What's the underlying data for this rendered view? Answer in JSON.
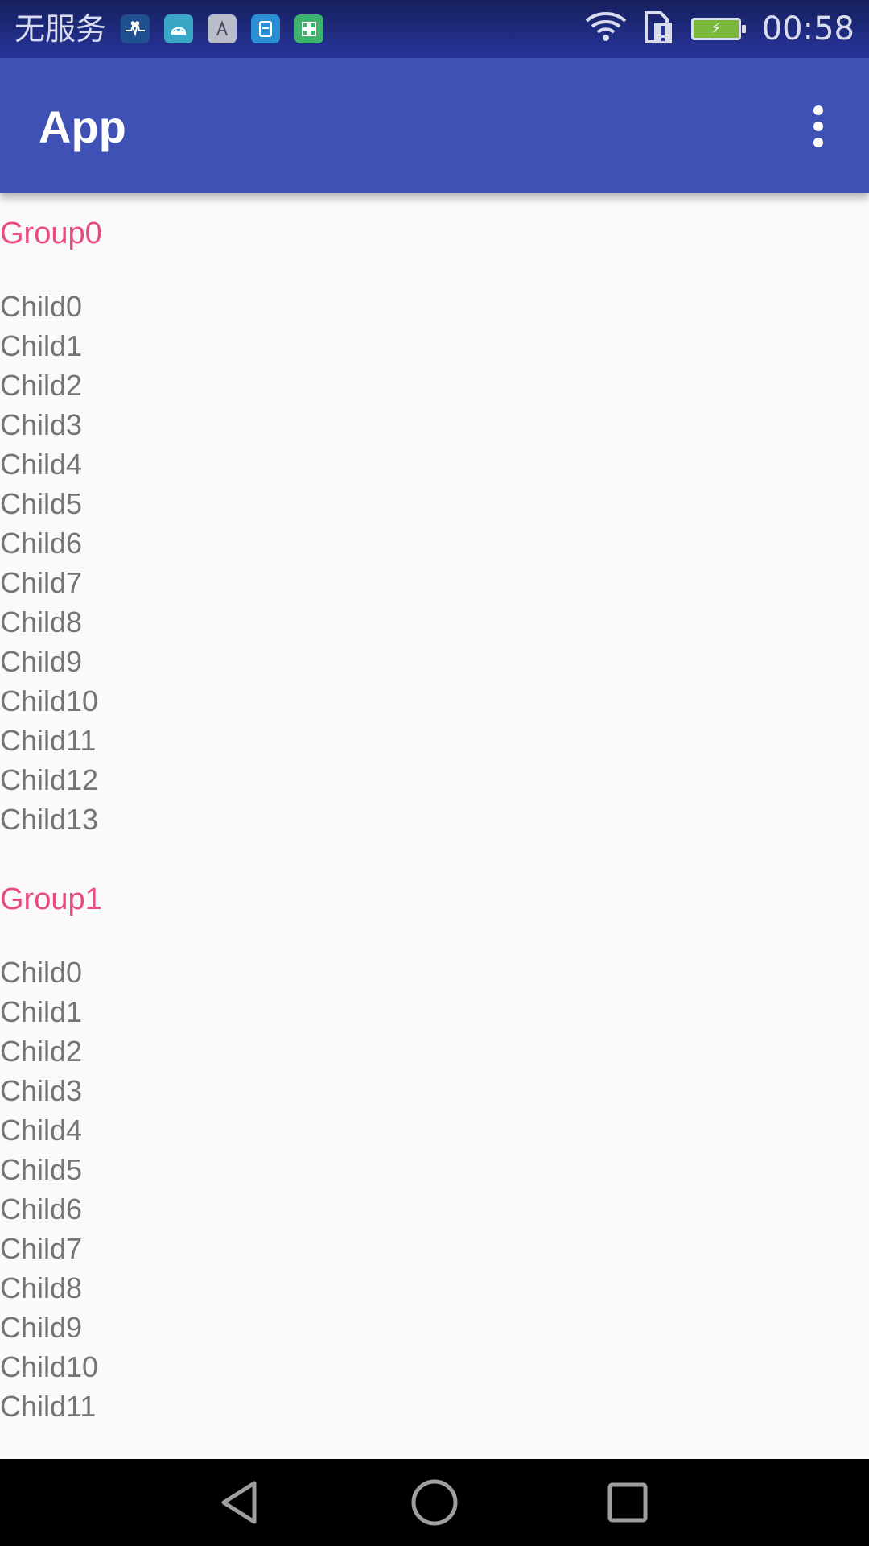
{
  "status_bar": {
    "carrier": "无服务",
    "time": "00:58",
    "notification_icons": [
      "health-icon",
      "android-icon",
      "font-icon",
      "card-icon",
      "grid-icon"
    ]
  },
  "app_bar": {
    "title": "App",
    "overflow_icon": "more-vert-icon"
  },
  "list": {
    "groups": [
      {
        "title": "Group0",
        "children": [
          "Child0",
          "Child1",
          "Child2",
          "Child3",
          "Child4",
          "Child5",
          "Child6",
          "Child7",
          "Child8",
          "Child9",
          "Child10",
          "Child11",
          "Child12",
          "Child13"
        ]
      },
      {
        "title": "Group1",
        "children": [
          "Child0",
          "Child1",
          "Child2",
          "Child3",
          "Child4",
          "Child5",
          "Child6",
          "Child7",
          "Child8",
          "Child9",
          "Child10",
          "Child11"
        ]
      }
    ]
  },
  "nav_bar": {
    "buttons": [
      "back-icon",
      "home-icon",
      "recents-icon"
    ]
  },
  "colors": {
    "primary": "#3f51b5",
    "status_bar": "#27349b",
    "group_text": "#e84a82",
    "child_text": "#757575",
    "background": "#fafafa",
    "nav_bar": "#000000"
  }
}
